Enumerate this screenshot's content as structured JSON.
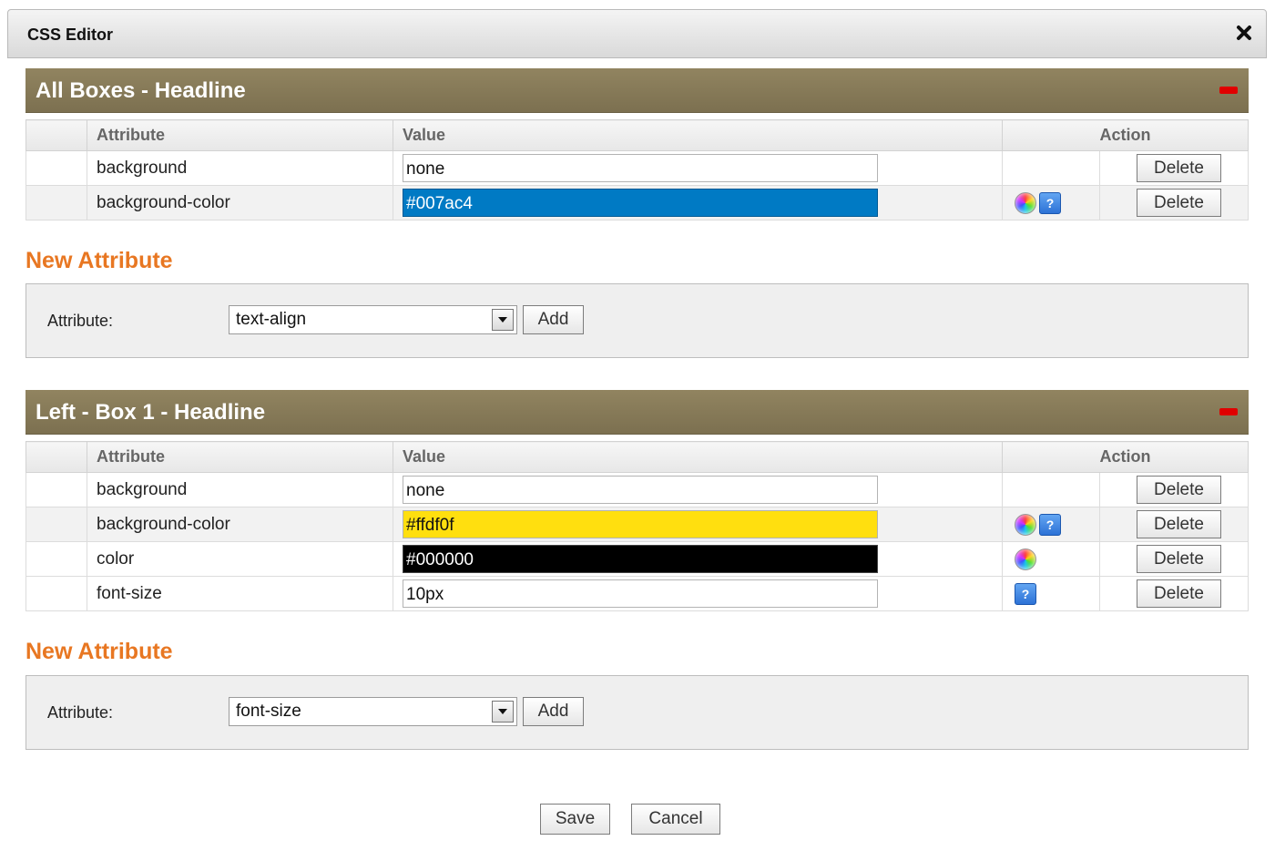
{
  "dialog": {
    "title": "CSS Editor"
  },
  "table_headers": {
    "attribute": "Attribute",
    "value": "Value",
    "action": "Action"
  },
  "sections": [
    {
      "title": "All Boxes - Headline",
      "rows": [
        {
          "attribute": "background",
          "value": "none",
          "bg": "#ffffff",
          "fg": "#111111",
          "color_picker": false,
          "help": false,
          "delete_label": "Delete"
        },
        {
          "attribute": "background-color",
          "value": "#007ac4",
          "bg": "#007ac4",
          "fg": "#ffffff",
          "color_picker": true,
          "help": true,
          "delete_label": "Delete"
        }
      ]
    },
    {
      "title": "Left - Box 1 - Headline",
      "rows": [
        {
          "attribute": "background",
          "value": "none",
          "bg": "#ffffff",
          "fg": "#111111",
          "color_picker": false,
          "help": false,
          "delete_label": "Delete"
        },
        {
          "attribute": "background-color",
          "value": "#ffdf0f",
          "bg": "#ffdf0f",
          "fg": "#111111",
          "color_picker": true,
          "help": true,
          "delete_label": "Delete"
        },
        {
          "attribute": "color",
          "value": "#000000",
          "bg": "#000000",
          "fg": "#ffffff",
          "color_picker": true,
          "help": false,
          "delete_label": "Delete"
        },
        {
          "attribute": "font-size",
          "value": "10px",
          "bg": "#ffffff",
          "fg": "#111111",
          "color_picker": false,
          "help": true,
          "delete_label": "Delete"
        }
      ]
    }
  ],
  "new_attribute": [
    {
      "title": "New Attribute",
      "label": "Attribute:",
      "selected": "text-align",
      "add_label": "Add"
    },
    {
      "title": "New Attribute",
      "label": "Attribute:",
      "selected": "font-size",
      "add_label": "Add"
    }
  ],
  "footer": {
    "save_label": "Save",
    "cancel_label": "Cancel"
  },
  "icons": {
    "close": "close-icon",
    "collapse": "minus-icon",
    "color_picker": "color-wheel-icon",
    "help": "help-icon",
    "dropdown": "chevron-down-icon"
  },
  "colors": {
    "section_header": "#877b56",
    "new_attr_title": "#e87722",
    "collapse": "#e00000"
  }
}
